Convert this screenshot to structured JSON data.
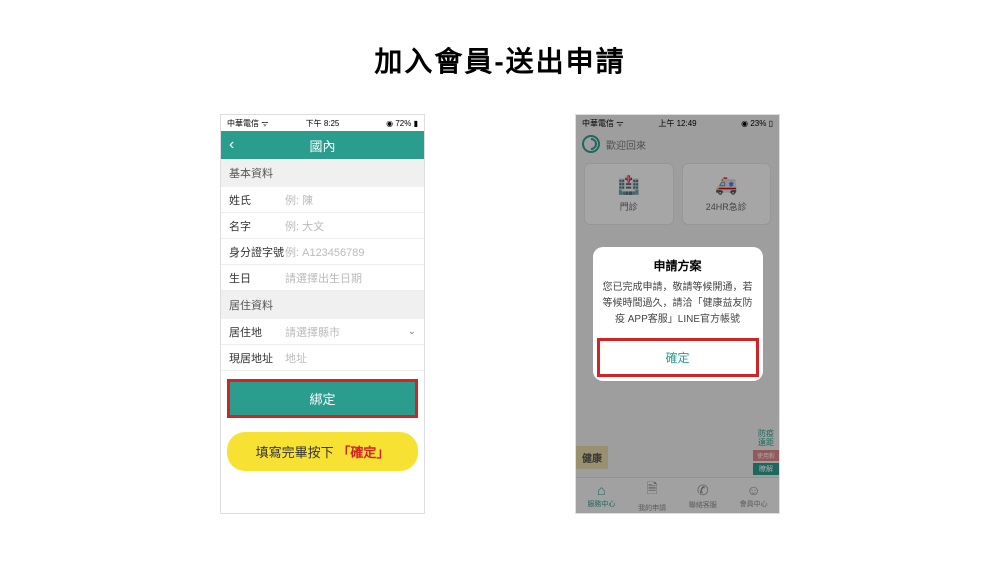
{
  "page_title": "加入會員-送出申請",
  "phone1": {
    "status": {
      "carrier": "中華電信",
      "time": "下午 8:25",
      "battery": "72%"
    },
    "nav_title": "國內",
    "sections": {
      "basic": "基本資料",
      "residence": "居住資料"
    },
    "fields": {
      "last_name": {
        "label": "姓氏",
        "placeholder": "例: 陳"
      },
      "first_name": {
        "label": "名字",
        "placeholder": "例: 大文"
      },
      "id_no": {
        "label": "身分證字號",
        "placeholder": "例: A123456789"
      },
      "birthday": {
        "label": "生日",
        "placeholder": "請選擇出生日期"
      },
      "city": {
        "label": "居住地",
        "placeholder": "請選擇縣市"
      },
      "address": {
        "label": "現居地址",
        "placeholder": "地址"
      }
    },
    "bind_button": "綁定",
    "callout_prefix": "填寫完畢按下",
    "callout_highlight": "「確定」"
  },
  "phone2": {
    "status": {
      "carrier": "中華電信",
      "time": "上午 12:49",
      "battery": "23%"
    },
    "welcome": "歡迎回來",
    "tiles": {
      "clinic": "門診",
      "emergency": "24HR急診"
    },
    "dialog": {
      "title": "申請方案",
      "body": "您已完成申請，敬請等候開通，若等候時間過久，請洽「健康益友防疫 APP客服」LINE官方帳號",
      "confirm": "確定"
    },
    "banner_left": "健康",
    "banner_right": {
      "line1": "防疫",
      "line2": "遠距",
      "tag1": "使用對",
      "tag2": "瞭解"
    },
    "tabs": {
      "service": "服務中心",
      "my": "我的申請",
      "contact": "聯絡客服",
      "member": "會員中心"
    }
  }
}
